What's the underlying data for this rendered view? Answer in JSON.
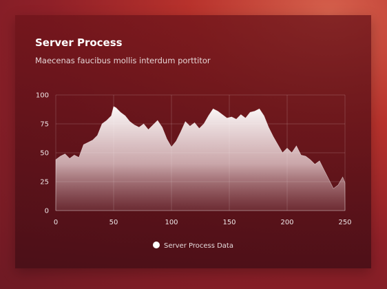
{
  "card": {
    "title": "Server Process",
    "subtitle": "Maecenas faucibus mollis interdum porttitor"
  },
  "chart_data": {
    "type": "area",
    "title": "Server Process",
    "subtitle": "Maecenas faucibus mollis interdum porttitor",
    "xlabel": "",
    "ylabel": "",
    "xlim": [
      0,
      250
    ],
    "ylim": [
      0,
      100
    ],
    "x_ticks": [
      0,
      50,
      100,
      150,
      200,
      250
    ],
    "y_ticks": [
      0,
      25,
      50,
      75,
      100
    ],
    "grid": true,
    "legend_position": "bottom",
    "fill_color": "#ffffff",
    "series": [
      {
        "name": "Server Process Data",
        "x": [
          0,
          4,
          8,
          12,
          16,
          20,
          24,
          28,
          32,
          36,
          40,
          44,
          48,
          50,
          52,
          56,
          60,
          64,
          68,
          72,
          76,
          80,
          84,
          88,
          92,
          96,
          100,
          104,
          108,
          112,
          116,
          120,
          124,
          128,
          132,
          136,
          140,
          144,
          148,
          152,
          156,
          160,
          164,
          168,
          172,
          176,
          180,
          184,
          188,
          192,
          196,
          200,
          204,
          208,
          212,
          216,
          220,
          224,
          228,
          232,
          236,
          240,
          244,
          248,
          250
        ],
        "y": [
          44,
          47,
          49,
          45,
          48,
          46,
          57,
          59,
          61,
          65,
          75,
          78,
          82,
          90,
          89,
          85,
          82,
          77,
          74,
          72,
          75,
          70,
          74,
          78,
          72,
          62,
          55,
          60,
          68,
          77,
          73,
          76,
          71,
          75,
          82,
          88,
          86,
          83,
          80,
          81,
          79,
          83,
          80,
          85,
          86,
          88,
          82,
          72,
          64,
          57,
          50,
          54,
          50,
          56,
          48,
          47,
          44,
          40,
          43,
          35,
          27,
          19,
          22,
          29,
          24
        ]
      }
    ]
  },
  "legend": {
    "label": "Server Process Data"
  }
}
